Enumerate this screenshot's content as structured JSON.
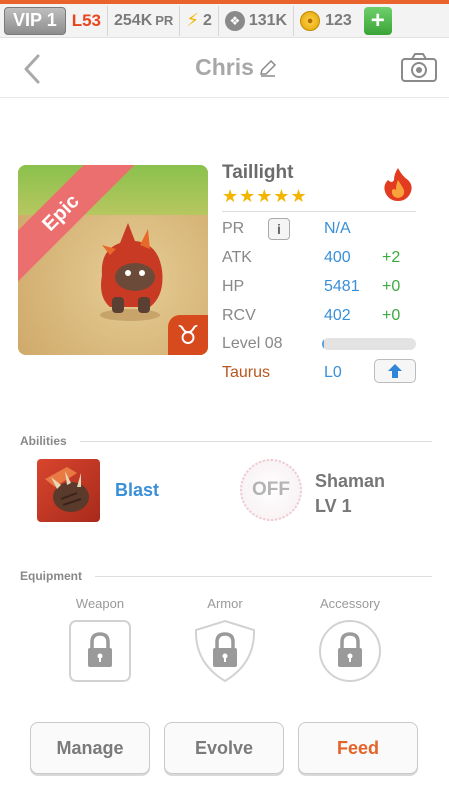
{
  "topbar": {
    "vip": "VIP 1",
    "level": "L53",
    "pr": "254K",
    "pr_unit": "PR",
    "energy": "2",
    "paws": "131K",
    "coins": "123",
    "add_icon": "plus-icon"
  },
  "header": {
    "title": "Chris",
    "back_icon": "chevron-left-icon",
    "edit_icon": "pencil-icon",
    "camera_icon": "camera-icon"
  },
  "monster": {
    "name": "Taillight",
    "rarity": "Epic",
    "stars": "★★★★★",
    "element_icon": "fire-icon",
    "zodiac_symbol": "♉",
    "stats": {
      "pr_label": "PR",
      "pr_value": "N/A",
      "atk_label": "ATK",
      "atk_value": "400",
      "atk_bonus": "+2",
      "hp_label": "HP",
      "hp_value": "5481",
      "hp_bonus": "+0",
      "rcv_label": "RCV",
      "rcv_value": "402",
      "rcv_bonus": "+0",
      "level_label": "Level 08",
      "level_progress": 0.02
    },
    "sign": "Taurus",
    "sign_level": "L0"
  },
  "abilities": {
    "section": "Abilities",
    "ability_name": "Blast",
    "off_label": "OFF",
    "shaman_line1": "Shaman",
    "shaman_line2": "LV 1"
  },
  "equipment": {
    "section": "Equipment",
    "slots": [
      "Weapon",
      "Armor",
      "Accessory"
    ]
  },
  "actions": {
    "manage": "Manage",
    "evolve": "Evolve",
    "feed": "Feed"
  },
  "colors": {
    "accent_orange": "#e8642c",
    "stat_blue": "#3a8fd8",
    "bonus_green": "#3caa3c",
    "epic_red": "#ec6f6f"
  }
}
